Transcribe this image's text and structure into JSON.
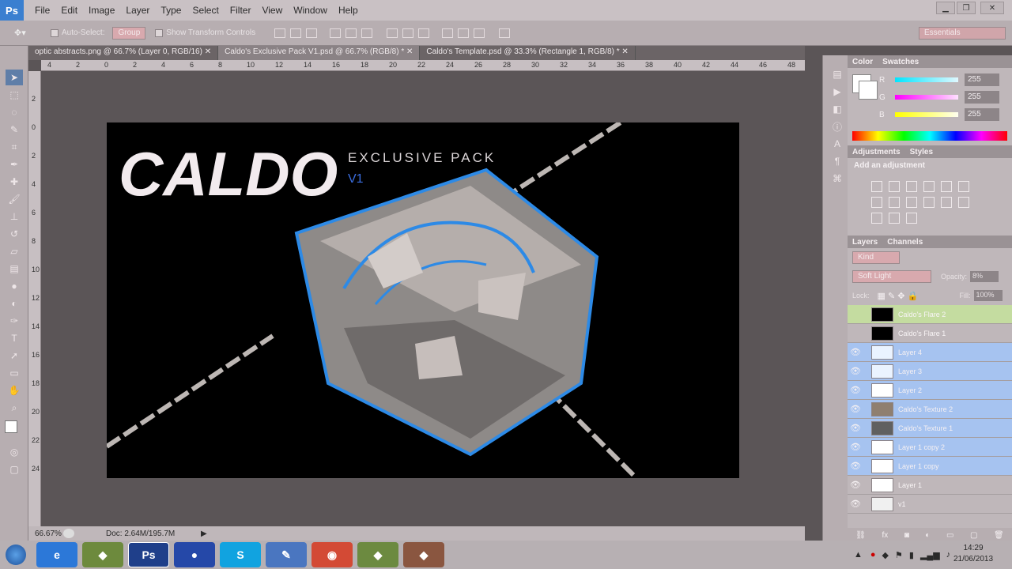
{
  "menubar": {
    "logo": "Ps",
    "items": [
      "File",
      "Edit",
      "Image",
      "Layer",
      "Type",
      "Select",
      "Filter",
      "View",
      "Window",
      "Help"
    ]
  },
  "options": {
    "auto_select": "Auto-Select:",
    "group": "Group",
    "show_transform": "Show Transform Controls",
    "workspace": "Essentials"
  },
  "tabs": [
    {
      "label": "optic abstracts.png @ 66.7% (Layer 0, RGB/16)"
    },
    {
      "label": "Caldo's Exclusive Pack V1.psd @ 66.7% (RGB/8) *"
    },
    {
      "label": "Caldo's Template.psd @ 33.3% (Rectangle 1, RGB/8) *"
    }
  ],
  "ruler_top": [
    "4",
    "2",
    "0",
    "2",
    "4",
    "6",
    "8",
    "10",
    "12",
    "14",
    "16",
    "18",
    "20",
    "22",
    "24",
    "26",
    "28",
    "30",
    "32",
    "34",
    "36",
    "38",
    "40",
    "42",
    "44",
    "46",
    "48"
  ],
  "ruler_left": [
    "2",
    "0",
    "2",
    "4",
    "6",
    "8",
    "10",
    "12",
    "14",
    "16",
    "18",
    "20",
    "22",
    "24"
  ],
  "artwork": {
    "logo_text": "CALDO",
    "subtitle": "EXCLUSIVE PACK",
    "version": "V1"
  },
  "status": {
    "zoom": "66.67%",
    "doc": "Doc: 2.64M/195.7M"
  },
  "color_panel": {
    "tabs": [
      "Color",
      "Swatches"
    ],
    "r": "255",
    "g": "255",
    "b": "255",
    "r_label": "R",
    "g_label": "G",
    "b_label": "B",
    "track_r": "#00e6ff",
    "track_g": "#ff00ff",
    "track_b": "#ffff00"
  },
  "adjustments": {
    "tabs": [
      "Adjustments",
      "Styles"
    ],
    "add_label": "Add an adjustment"
  },
  "layers_panel": {
    "tabs": [
      "Layers",
      "Channels"
    ],
    "kind": "Kind",
    "blend": "Soft Light",
    "opacity_label": "Opacity:",
    "opacity": "8%",
    "lock_label": "Lock:",
    "fill_label": "Fill:",
    "fill": "100%",
    "layers": [
      {
        "name": "Caldo's Flare 2",
        "visible": false,
        "selected": false,
        "thumb": "#000"
      },
      {
        "name": "Caldo's Flare 1",
        "visible": false,
        "selected": false,
        "thumb": "#000"
      },
      {
        "name": "Layer 4",
        "visible": true,
        "selected": true,
        "thumb": "#eaf3ff"
      },
      {
        "name": "Layer 3",
        "visible": true,
        "selected": true,
        "thumb": "#eaf3ff"
      },
      {
        "name": "Layer 2",
        "visible": true,
        "selected": true,
        "thumb": "#ffffff"
      },
      {
        "name": "Caldo's Texture 2",
        "visible": true,
        "selected": true,
        "thumb": "#8f7f70"
      },
      {
        "name": "Caldo's Texture 1",
        "visible": true,
        "selected": true,
        "thumb": "#606060"
      },
      {
        "name": "Layer 1 copy 2",
        "visible": true,
        "selected": true,
        "thumb": "#ffffff"
      },
      {
        "name": "Layer 1 copy",
        "visible": true,
        "selected": true,
        "thumb": "#ffffff"
      },
      {
        "name": "Layer 1",
        "visible": true,
        "selected": false,
        "thumb": "#ffffff"
      },
      {
        "name": "v1",
        "visible": true,
        "selected": false,
        "thumb": "#f0f0f0"
      }
    ]
  },
  "taskbar": {
    "apps": [
      "IE",
      "Explorer",
      "Ps",
      "Globe",
      "Skype",
      "Notes",
      "Chrome",
      "App",
      "App2"
    ],
    "time": "14:29",
    "date": "21/06/2013"
  }
}
